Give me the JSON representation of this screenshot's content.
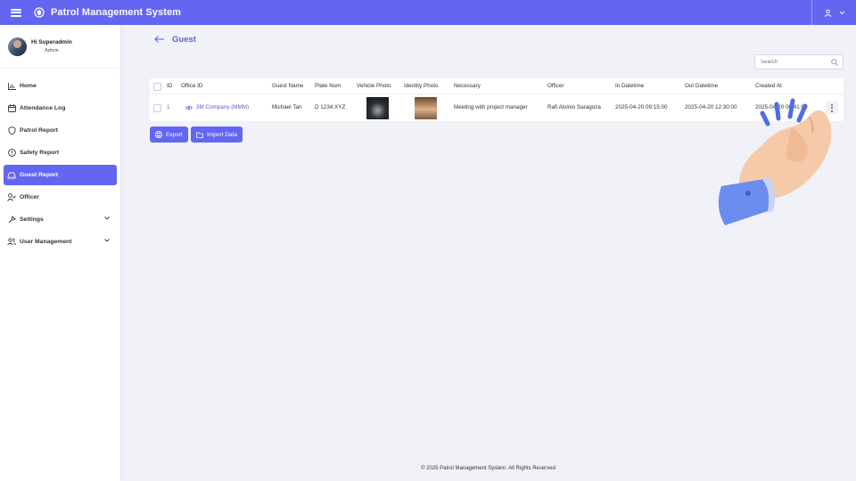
{
  "app": {
    "title": "Patrol Management System",
    "accent_color": "#6366f1"
  },
  "topbar": {
    "menu_icon": "hamburger-icon",
    "logo_icon": "shield-logo-icon",
    "user_icon": "user-icon",
    "dropdown_icon": "chevron-down-icon"
  },
  "profile": {
    "greeting": "Hi Superadmin",
    "role": "Admin"
  },
  "sidebar": {
    "items": [
      {
        "label": "Home",
        "icon": "chart-icon",
        "active": false
      },
      {
        "label": "Attendance Log",
        "icon": "calendar-icon",
        "active": false
      },
      {
        "label": "Patrol Report",
        "icon": "shield-icon",
        "active": false
      },
      {
        "label": "Safety Report",
        "icon": "alert-circle-icon",
        "active": false
      },
      {
        "label": "Guest Report",
        "icon": "car-icon",
        "active": true
      },
      {
        "label": "Officer",
        "icon": "user-check-icon",
        "active": false
      },
      {
        "label": "Settings",
        "icon": "wrench-icon",
        "active": false,
        "expandable": true
      },
      {
        "label": "User Management",
        "icon": "users-icon",
        "active": false,
        "expandable": true
      }
    ]
  },
  "page": {
    "title": "Guest"
  },
  "search": {
    "placeholder": "Search"
  },
  "table": {
    "columns": [
      "ID",
      "Office ID",
      "Guest Name",
      "Plate Num",
      "Vehicle Photo",
      "Identity Photo",
      "Necessary",
      "Officer",
      "In Datetime",
      "Out Datetime",
      "Created At"
    ],
    "rows": [
      {
        "id": "1",
        "office_id": "3M Company (MMM)",
        "guest_name": "Michael Tan",
        "plate_num": "D 1234 XYZ",
        "necessary": "Meeting with project manager",
        "officer": "Rafi Alvinio Saragoza",
        "in_datetime": "2025-04-20 09:15:00",
        "out_datetime": "2025-04-20 12:30:00",
        "created_at": "2025-04-20 00:41:03"
      }
    ]
  },
  "actions": {
    "export_label": "Export",
    "import_label": "Import Data"
  },
  "footer": {
    "text": "© 2025 Patrol Management System. All Rights Reserved"
  }
}
